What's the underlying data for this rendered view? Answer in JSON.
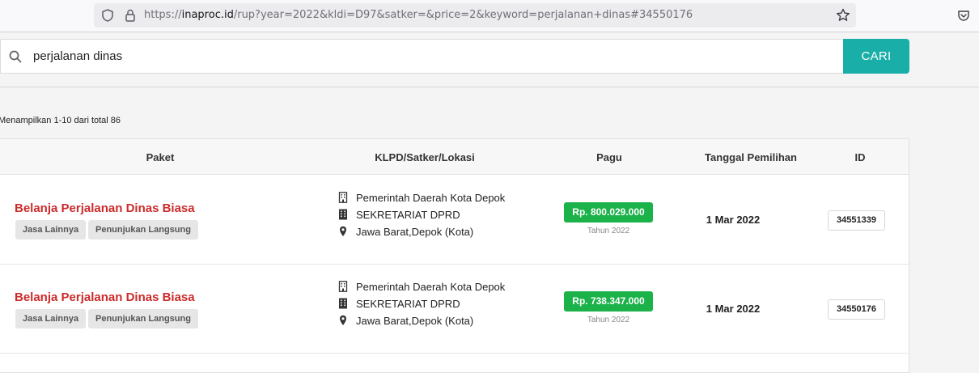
{
  "browser": {
    "url_prefix": "https://",
    "url_domain": "inaproc.id",
    "url_rest": "/rup?year=2022&kldi=D97&satker=&price=2&keyword=perjalanan+dinas#34550176"
  },
  "search": {
    "value": "perjalanan dinas",
    "button_label": "CARI"
  },
  "results": {
    "count_text": "Menampilkan 1-10 dari total 86"
  },
  "table": {
    "headers": {
      "paket": "Paket",
      "klpd": "KLPD/Satker/Lokasi",
      "pagu": "Pagu",
      "tanggal": "Tanggal Pemilihan",
      "id": "ID"
    },
    "rows": [
      {
        "title": "Belanja Perjalanan Dinas Biasa",
        "tags": [
          "Jasa Lainnya",
          "Penunjukan Langsung"
        ],
        "klpd": "Pemerintah Daerah Kota Depok",
        "satker": "SEKRETARIAT DPRD",
        "lokasi": "Jawa Barat,Depok (Kota)",
        "pagu": "Rp. 800.029.000",
        "tahun": "Tahun 2022",
        "tanggal": "1 Mar 2022",
        "id": "34551339"
      },
      {
        "title": "Belanja Perjalanan Dinas Biasa",
        "tags": [
          "Jasa Lainnya",
          "Penunjukan Langsung"
        ],
        "klpd": "Pemerintah Daerah Kota Depok",
        "satker": "SEKRETARIAT DPRD",
        "lokasi": "Jawa Barat,Depok (Kota)",
        "pagu": "Rp. 738.347.000",
        "tahun": "Tahun 2022",
        "tanggal": "1 Mar 2022",
        "id": "34550176"
      }
    ]
  },
  "colors": {
    "accent": "#1aaea9",
    "title_red": "#cc2b2b",
    "pagu_green": "#1bb24a"
  }
}
